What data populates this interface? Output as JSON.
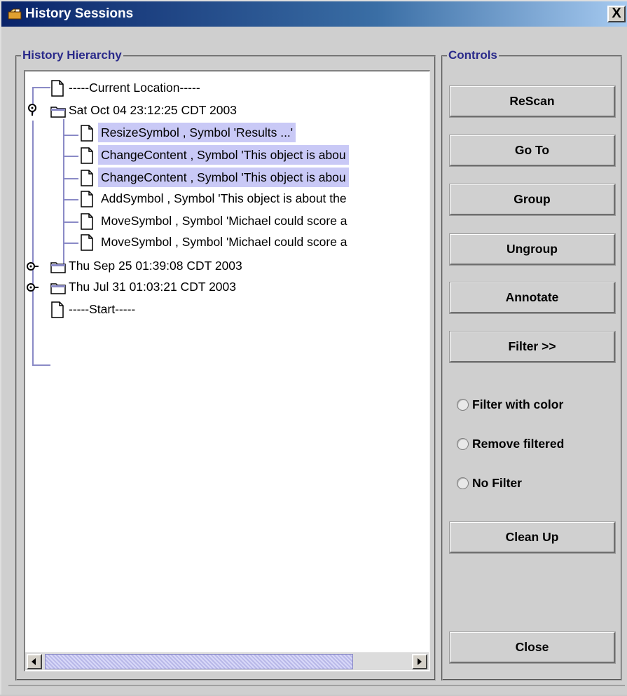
{
  "window": {
    "title": "History Sessions",
    "close_glyph": "X"
  },
  "hierarchy": {
    "legend": "History Hierarchy",
    "rows": [
      {
        "label": "-----Current Location-----",
        "icon": "file-icon",
        "selected": false
      },
      {
        "label": "Sat Oct 04 23:12:25 CDT 2003",
        "icon": "folder-icon",
        "expanded": true,
        "selected": false
      },
      {
        "label": "ResizeSymbol , Symbol 'Results ...'",
        "icon": "file-icon",
        "selected": true
      },
      {
        "label": "ChangeContent , Symbol 'This object is abou",
        "icon": "file-icon",
        "selected": true
      },
      {
        "label": "ChangeContent , Symbol 'This object is abou",
        "icon": "file-icon",
        "selected": true
      },
      {
        "label": "AddSymbol , Symbol 'This object is about the",
        "icon": "file-icon",
        "selected": false
      },
      {
        "label": "MoveSymbol , Symbol 'Michael could score a",
        "icon": "file-icon",
        "selected": false
      },
      {
        "label": "MoveSymbol , Symbol 'Michael could score a",
        "icon": "file-icon",
        "selected": false
      },
      {
        "label": "Thu Sep 25 01:39:08 CDT 2003",
        "icon": "folder-icon",
        "expanded": false,
        "selected": false
      },
      {
        "label": "Thu Jul 31 01:03:21 CDT 2003",
        "icon": "folder-icon",
        "expanded": false,
        "selected": false
      },
      {
        "label": "-----Start-----",
        "icon": "file-icon",
        "selected": false
      }
    ]
  },
  "controls": {
    "legend": "Controls",
    "buttons": {
      "rescan": "ReScan",
      "goto": "Go To",
      "group": "Group",
      "ungroup": "Ungroup",
      "annotate": "Annotate",
      "filter": "Filter >>",
      "cleanup": "Clean Up",
      "close": "Close"
    },
    "radios": {
      "filter_with_color": "Filter with color",
      "remove_filtered": "Remove filtered",
      "no_filter": "No Filter"
    }
  },
  "colors": {
    "title_start": "#0a246a",
    "selection": "#c9c9f6",
    "legend": "#2a2a8a"
  }
}
